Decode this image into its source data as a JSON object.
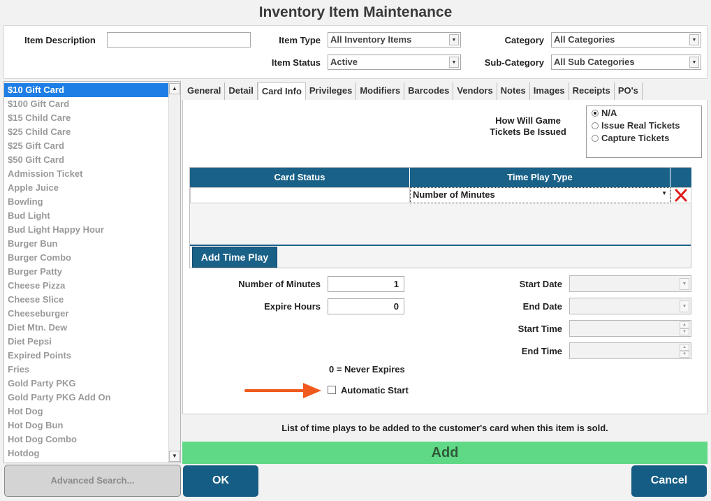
{
  "window": {
    "title": "Inventory Item Maintenance"
  },
  "filters": {
    "item_description_label": "Item Description",
    "item_description_value": "",
    "item_type_label": "Item Type",
    "item_type_value": "All Inventory Items",
    "item_status_label": "Item Status",
    "item_status_value": "Active",
    "category_label": "Category",
    "category_value": "All Categories",
    "sub_category_label": "Sub-Category",
    "sub_category_value": "All Sub Categories"
  },
  "item_list": {
    "items": [
      "$10 Gift Card",
      "$100 Gift Card",
      "$15 Child Care",
      "$25 Child Care",
      "$25 Gift Card",
      "$50 Gift Card",
      "Admission Ticket",
      "Apple Juice",
      "Bowling",
      "Bud Light",
      "Bud Light Happy Hour",
      "Burger Bun",
      "Burger Combo",
      "Burger Patty",
      "Cheese Pizza",
      "Cheese Slice",
      "Cheeseburger",
      "Diet Mtn. Dew",
      "Diet Pepsi",
      "Expired Points",
      "Fries",
      "Gold Party PKG",
      "Gold Party PKG Add On",
      "Hot Dog",
      "Hot Dog Bun",
      "Hot Dog Combo",
      "Hotdog"
    ],
    "selected": "$10 Gift Card",
    "selected_color": "#1e7ee6",
    "advanced_search_label": "Advanced Search..."
  },
  "tabs": [
    "General",
    "Detail",
    "Card Info",
    "Privileges",
    "Modifiers",
    "Barcodes",
    "Vendors",
    "Notes",
    "Images",
    "Receipts",
    "PO's"
  ],
  "active_tab": "Card Info",
  "card_info": {
    "game_tickets_label_line1": "How Will Game",
    "game_tickets_label_line2": "Tickets Be Issued",
    "ticket_options": [
      "N/A",
      "Issue Real Tickets",
      "Capture Tickets"
    ],
    "ticket_selected": "N/A",
    "grid": {
      "columns": [
        "Card Status",
        "Time Play Type"
      ],
      "row": {
        "card_status": "",
        "time_play_type": "Number of Minutes"
      },
      "header_color": "#1a6188"
    },
    "add_time_play_label": "Add Time Play",
    "number_of_minutes_label": "Number of Minutes",
    "number_of_minutes_value": "1",
    "expire_hours_label": "Expire Hours",
    "expire_hours_value": "0",
    "start_date_label": "Start Date",
    "end_date_label": "End Date",
    "start_time_label": "Start Time",
    "end_time_label": "End Time",
    "never_expires_note": "0 = Never Expires",
    "automatic_start_label": "Automatic Start",
    "automatic_start_checked": false,
    "arrow_color": "#f05a1e"
  },
  "footer": {
    "hint": "List of time plays to be added to the customer's card when this item is sold.",
    "add_label": "Add",
    "add_color": "#60d987",
    "ok_label": "OK",
    "cancel_label": "Cancel",
    "button_color": "#155d85"
  }
}
